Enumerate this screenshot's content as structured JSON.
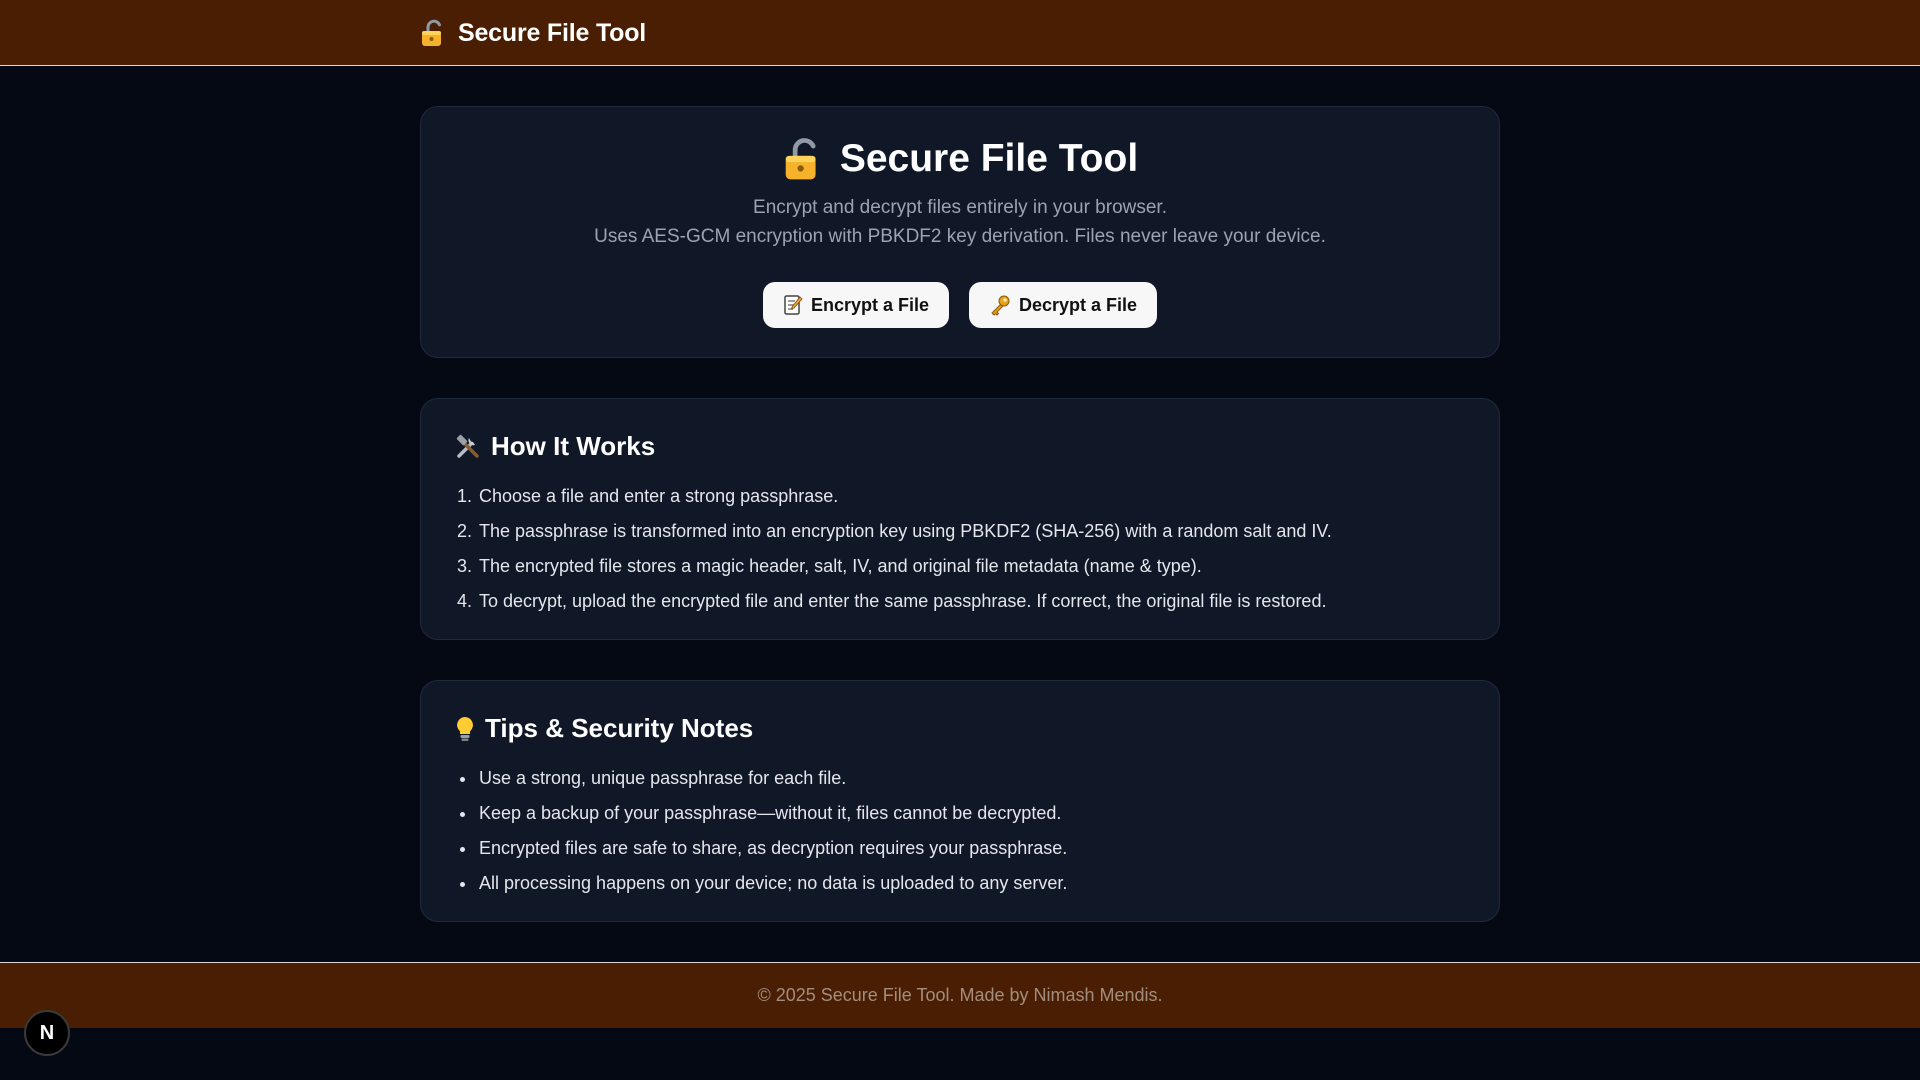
{
  "header": {
    "title": "Secure File Tool",
    "icon": "lock-icon"
  },
  "hero": {
    "title": "Secure File Tool",
    "subtitle_line1": "Encrypt and decrypt files entirely in your browser.",
    "subtitle_line2": "Uses AES-GCM encryption with PBKDF2 key derivation. Files never leave your device.",
    "encrypt_button": "Encrypt a File",
    "decrypt_button": "Decrypt a File"
  },
  "how_it_works": {
    "title": "How It Works",
    "icon": "tools-icon",
    "steps": [
      "Choose a file and enter a strong passphrase.",
      "The passphrase is transformed into an encryption key using PBKDF2 (SHA-256) with a random salt and IV.",
      "The encrypted file stores a magic header, salt, IV, and original file metadata (name & type).",
      "To decrypt, upload the encrypted file and enter the same passphrase. If correct, the original file is restored."
    ]
  },
  "tips": {
    "title": "Tips & Security Notes",
    "icon": "lightbulb-icon",
    "items": [
      "Use a strong, unique passphrase for each file.",
      "Keep a backup of your passphrase—without it, files cannot be decrypted.",
      "Encrypted files are safe to share, as decryption requires your passphrase.",
      "All processing happens on your device; no data is uploaded to any server."
    ]
  },
  "footer": {
    "text": "© 2025 Secure File Tool. Made by Nimash Mendis."
  },
  "dev_badge": {
    "label": "N"
  },
  "colors": {
    "bar_brown": "#4a1e02",
    "page_bg": "#040914",
    "card_bg": "#101827",
    "button_bg": "#f7f7f8"
  }
}
